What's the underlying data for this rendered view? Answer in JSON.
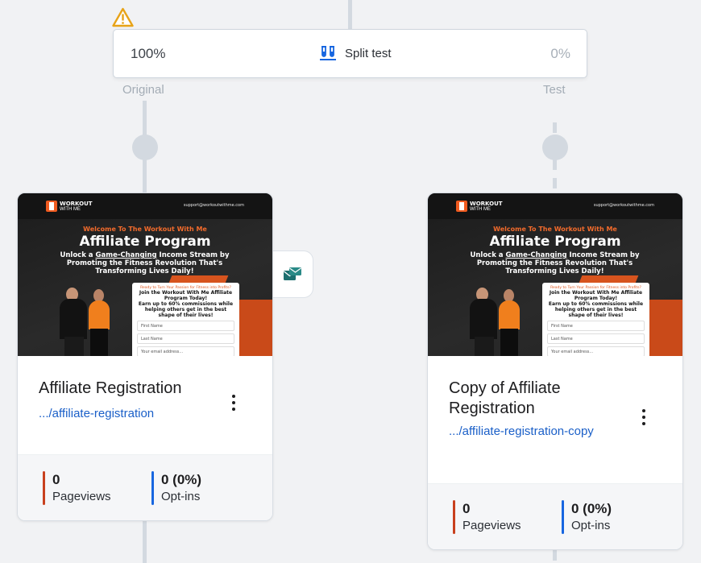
{
  "split_test": {
    "label": "Split test",
    "original_percent": "100%",
    "test_percent": "0%",
    "original_label": "Original",
    "test_label": "Test",
    "icon": "flask-split-icon",
    "warning_icon": "warning-triangle-icon"
  },
  "action_button": {
    "icon": "email-action-icon"
  },
  "cards": [
    {
      "title": "Affiliate Registration",
      "link": ".../affiliate-registration",
      "pageviews_value": "0",
      "pageviews_label": "Pageviews",
      "optins_value": "0 (0%)",
      "optins_label": "Opt-ins"
    },
    {
      "title": "Copy of Affiliate Registration",
      "link": ".../affiliate-registration-copy",
      "pageviews_value": "0",
      "pageviews_label": "Pageviews",
      "optins_value": "0 (0%)",
      "optins_label": "Opt-ins"
    }
  ],
  "thumbnail": {
    "brand_line1": "WORKOUT",
    "brand_line2": "WITH ME",
    "email": "support@workoutwithme.com",
    "welcome": "Welcome To The Workout With Me",
    "headline": "Affiliate Program",
    "sub_pre": "Unlock a ",
    "sub_underline": "Game-Changing",
    "sub_post": " Income Stream by Promoting the Fitness Revolution That's Transforming Lives Daily!",
    "form_kicker": "Ready to Turn Your Passion for Fitness into Profits?",
    "form_heading": "Join the Workout With Me Affiliate Program Today!",
    "form_sub": "Earn up to 60% commissions while helping others get in the best shape of their lives!",
    "field1": "First Name",
    "field2": "Last Name",
    "field3": "Your email address..."
  },
  "colors": {
    "pageviews_bar": "#c8401e",
    "optins_bar": "#1766e0",
    "link": "#1a5fc8",
    "accent_orange": "#e0561d"
  }
}
